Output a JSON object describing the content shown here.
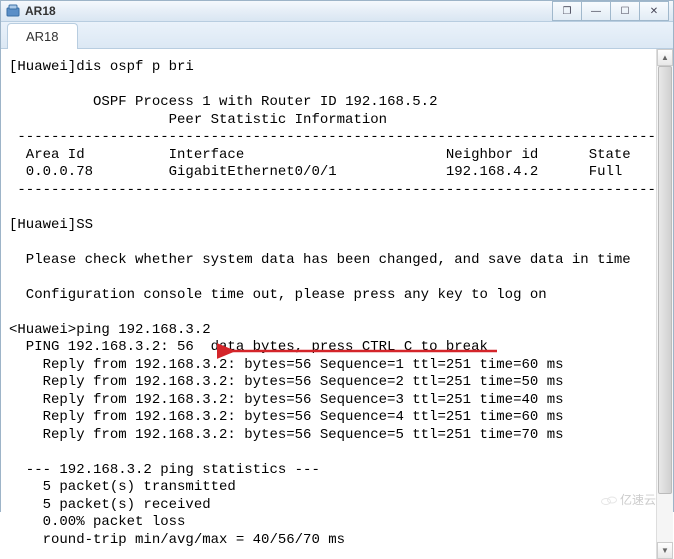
{
  "window": {
    "title": "AR18",
    "controls": {
      "restore": "❐",
      "minimize": "—",
      "maximize": "☐",
      "close": "✕"
    }
  },
  "tab": {
    "label": "AR18"
  },
  "terminal": {
    "lines": [
      "[Huawei]dis ospf p bri",
      "",
      "\t  OSPF Process 1 with Router ID 192.168.5.2",
      "\t\t   Peer Statistic Information",
      " ----------------------------------------------------------------------------",
      "  Area Id          Interface                        Neighbor id      State",
      "  0.0.0.78         GigabitEthernet0/0/1             192.168.4.2      Full",
      " ----------------------------------------------------------------------------",
      "",
      "[Huawei]SS",
      "",
      "  Please check whether system data has been changed, and save data in time",
      "",
      "  Configuration console time out, please press any key to log on",
      "",
      "<Huawei>ping 192.168.3.2",
      "  PING 192.168.3.2: 56  data bytes, press CTRL_C to break",
      "    Reply from 192.168.3.2: bytes=56 Sequence=1 ttl=251 time=60 ms",
      "    Reply from 192.168.3.2: bytes=56 Sequence=2 ttl=251 time=50 ms",
      "    Reply from 192.168.3.2: bytes=56 Sequence=3 ttl=251 time=40 ms",
      "    Reply from 192.168.3.2: bytes=56 Sequence=4 ttl=251 time=60 ms",
      "    Reply from 192.168.3.2: bytes=56 Sequence=5 ttl=251 time=70 ms",
      "",
      "  --- 192.168.3.2 ping statistics ---",
      "    5 packet(s) transmitted",
      "    5 packet(s) received",
      "    0.00% packet loss",
      "    round-trip min/avg/max = 40/56/70 ms"
    ]
  },
  "watermark": {
    "text": "亿速云"
  }
}
